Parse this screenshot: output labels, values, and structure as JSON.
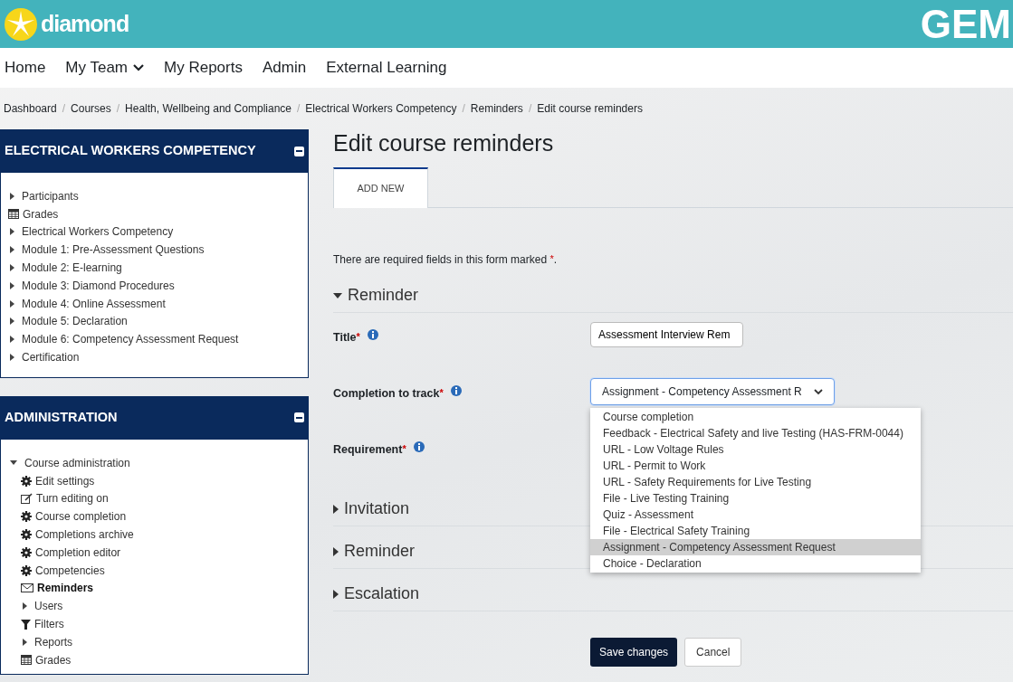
{
  "header": {
    "logo_text": "diamond",
    "right_text": "GEM"
  },
  "nav": [
    {
      "label": "Home",
      "dropdown": false
    },
    {
      "label": "My Team",
      "dropdown": true
    },
    {
      "label": "My Reports",
      "dropdown": false
    },
    {
      "label": "Admin",
      "dropdown": false
    },
    {
      "label": "External Learning",
      "dropdown": false
    }
  ],
  "breadcrumb": [
    {
      "label": "Dashboard"
    },
    {
      "separator": "/",
      "label": "Courses"
    },
    {
      "separator": "/",
      "label": "Health, Wellbeing and Compliance"
    },
    {
      "separator": "/",
      "label": "Electrical Workers Competency"
    },
    {
      "separator": "/",
      "label": "Reminders"
    },
    {
      "separator": "/",
      "label": "Edit course reminders"
    }
  ],
  "blocks": [
    {
      "title": "ELECTRICAL WORKERS COMPETENCY",
      "items": [
        {
          "label": "Participants",
          "kind": "caret",
          "current": false
        },
        {
          "label": "Grades",
          "kind": "grid",
          "current": false
        },
        {
          "label": "Electrical Workers Competency",
          "kind": "caret",
          "current": false
        },
        {
          "label": "Module 1: Pre-Assessment Questions",
          "kind": "caret",
          "current": false
        },
        {
          "label": "Module 2: E-learning",
          "kind": "caret",
          "current": false
        },
        {
          "label": "Module 3: Diamond Procedures",
          "kind": "caret",
          "current": false
        },
        {
          "label": "Module 4: Online Assessment",
          "kind": "caret",
          "current": false
        },
        {
          "label": "Module 5: Declaration",
          "kind": "caret",
          "current": false
        },
        {
          "label": "Module 6: Competency Assessment Request",
          "kind": "caret",
          "current": false
        },
        {
          "label": "Certification",
          "kind": "caret",
          "current": false
        }
      ]
    },
    {
      "title": "ADMINISTRATION",
      "items": [
        {
          "label": "Course administration",
          "kind": "expanded",
          "current": false,
          "children": [
            {
              "label": "Edit settings",
              "kind": "gear",
              "current": false
            },
            {
              "label": "Turn editing on",
              "kind": "edit",
              "current": false
            },
            {
              "label": "Course completion",
              "kind": "gear",
              "current": false
            },
            {
              "label": "Completions archive",
              "kind": "gear",
              "current": false
            },
            {
              "label": "Completion editor",
              "kind": "gear",
              "current": false
            },
            {
              "label": "Competencies",
              "kind": "gear",
              "current": false
            },
            {
              "label": "Reminders",
              "kind": "mail",
              "current": true
            },
            {
              "label": "Users",
              "kind": "caret",
              "current": false
            },
            {
              "label": "Filters",
              "kind": "filter",
              "current": false
            },
            {
              "label": "Reports",
              "kind": "caret",
              "current": false
            },
            {
              "label": "Grades",
              "kind": "grid",
              "current": false
            }
          ]
        }
      ]
    }
  ],
  "page_title": "Edit course reminders",
  "tabs": [
    {
      "label": "ADD NEW",
      "selected": true
    }
  ],
  "required_note": "There are required fields in this form marked",
  "required_mark": "*",
  "note_end": ".",
  "sections": [
    {
      "title": "Reminder",
      "expanded": true
    },
    {
      "title": "Invitation",
      "expanded": false
    },
    {
      "title": "Reminder",
      "expanded": false
    },
    {
      "title": "Escalation",
      "expanded": false
    }
  ],
  "fields": [
    {
      "label": "Title",
      "kind": "text",
      "value": "Assessment Interview Rem"
    },
    {
      "label": "Completion to track",
      "kind": "select",
      "value": "Assignment - Competency Assessment R",
      "options": [
        {
          "label": "Course completion",
          "selected": false
        },
        {
          "label": "Feedback - Electrical Safety and live Testing (HAS-FRM-0044)",
          "selected": false
        },
        {
          "label": "URL - Low Voltage Rules",
          "selected": false
        },
        {
          "label": "URL - Permit to Work",
          "selected": false
        },
        {
          "label": "URL - Safety Requirements for Live Testing",
          "selected": false
        },
        {
          "label": "File - Live Testing Training",
          "selected": false
        },
        {
          "label": "Quiz - Assessment",
          "selected": false
        },
        {
          "label": "File - Electrical Safety Training",
          "selected": false
        },
        {
          "label": "Assignment - Competency Assessment Request",
          "selected": true
        },
        {
          "label": "Choice - Declaration",
          "selected": false
        }
      ]
    },
    {
      "label": "Requirement",
      "kind": "none"
    }
  ],
  "buttons": [
    {
      "label": "Save changes",
      "kind": "primary"
    },
    {
      "label": "Cancel",
      "kind": "secondary"
    }
  ]
}
